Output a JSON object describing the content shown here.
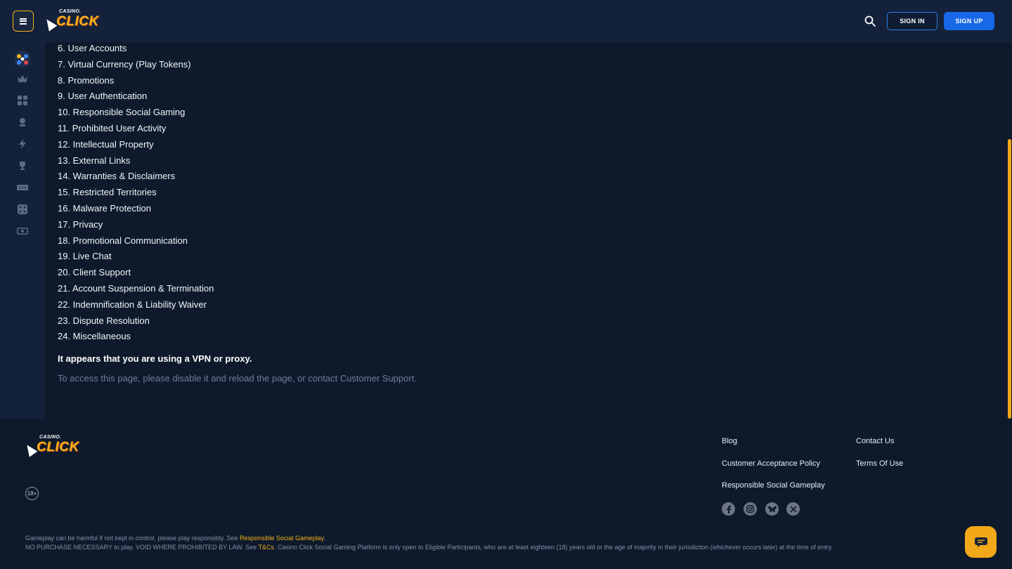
{
  "header": {
    "logo_small": "CASINO.",
    "logo_big": "CLICK",
    "sign_in": "SIGN IN",
    "sign_up": "SIGN UP"
  },
  "sidebar": {
    "icons": [
      "mascot-icon",
      "crown-icon",
      "grid-icon",
      "live-casino-icon",
      "lightning-icon",
      "trophy-icon",
      "ticket-icon",
      "dice-icon",
      "cash-icon"
    ]
  },
  "toc": [
    "6. User Accounts",
    "7. Virtual Currency (Play Tokens)",
    "8. Promotions",
    "9. User Authentication",
    "10. Responsible Social Gaming",
    "11. Prohibited User Activity",
    "12. Intellectual Property",
    "13. External Links",
    "14. Warranties & Disclaimers",
    "15. Restricted Territories",
    "16. Malware Protection",
    "17. Privacy",
    "18. Promotional Communication",
    "19. Live Chat",
    "20. Client Support",
    "21. Account Suspension & Termination",
    "22. Indemnification & Liability Waiver",
    "23. Dispute Resolution",
    "24. Miscellaneous"
  ],
  "notice": {
    "title": "It appears that you are using a VPN or proxy.",
    "text": "To access this page, please disable it and reload the page, or contact Customer Support."
  },
  "footer": {
    "logo_small": "CASINO.",
    "logo_big": "CLICK",
    "age_badge": "18+",
    "links": {
      "blog": "Blog",
      "contact": "Contact Us",
      "acceptance": "Customer Acceptance Policy",
      "terms": "Terms Of Use",
      "responsible": "Responsible Social Gameplay"
    },
    "social": [
      "facebook-icon",
      "instagram-icon",
      "bluesky-icon",
      "x-icon"
    ],
    "disclaimer1_pre": "Gameplay can be harmful if not kept in control, please play responsibly. See ",
    "disclaimer1_link": "Responsible Social Gameplay",
    "disclaimer1_post": ".",
    "disclaimer2_pre": "NO PURCHASE NECESSARY to play. VOID WHERE PROHIBITED BY LAW. See ",
    "disclaimer2_link": "T&Cs",
    "disclaimer2_post": ". Casino Click Social Gaming Platform is only open to Eligible Participants, who are at least eighteen (18) years old or the age of majority in their jurisdiction (whichever occurs later) at the time of entry."
  },
  "colors": {
    "accent": "#f2b418",
    "primary_button": "#1668e6",
    "background": "#0e1a2b",
    "panel": "#14213a"
  }
}
